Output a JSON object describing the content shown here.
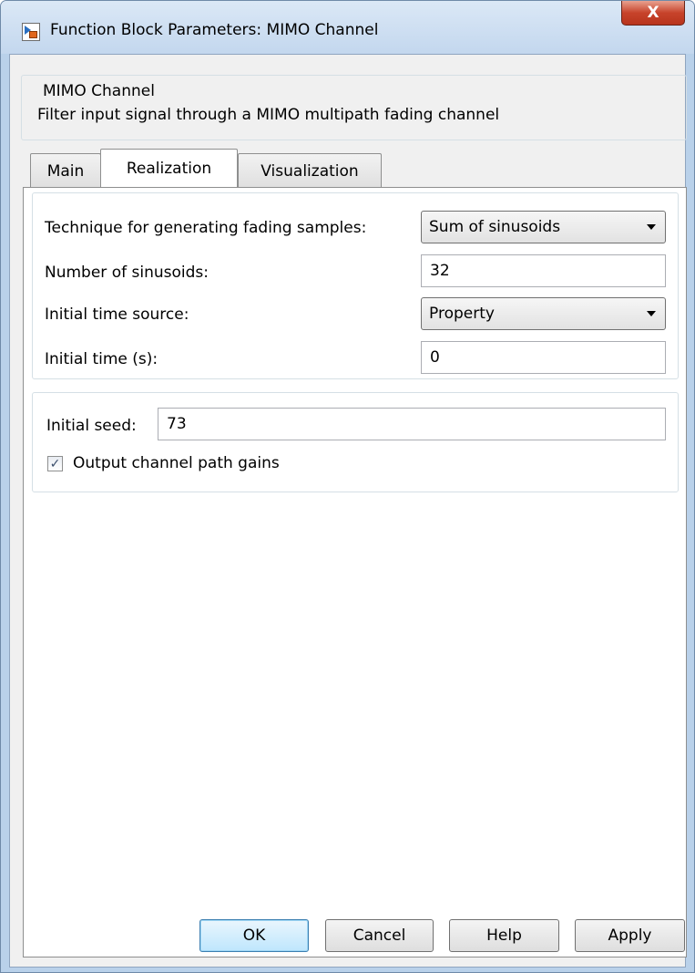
{
  "window": {
    "title": "Function Block Parameters: MIMO Channel",
    "close_glyph": "X"
  },
  "description": {
    "legend": "MIMO Channel",
    "text": "Filter input signal through a MIMO multipath fading channel"
  },
  "tabs": [
    {
      "label": "Main",
      "active": false
    },
    {
      "label": "Realization",
      "active": true
    },
    {
      "label": "Visualization",
      "active": false
    }
  ],
  "realization": {
    "technique": {
      "label": "Technique for generating fading samples:",
      "value": "Sum of sinusoids"
    },
    "num_sinusoids": {
      "label": "Number of sinusoids:",
      "value": "32"
    },
    "initial_time_source": {
      "label": "Initial time source:",
      "value": "Property"
    },
    "initial_time": {
      "label": "Initial time (s):",
      "value": "0"
    },
    "initial_seed": {
      "label": "Initial seed:",
      "value": "73"
    },
    "output_gains": {
      "label": "Output channel path gains",
      "checked": true,
      "check_glyph": "✓"
    }
  },
  "buttons": {
    "ok": "OK",
    "cancel": "Cancel",
    "help": "Help",
    "apply": "Apply"
  }
}
